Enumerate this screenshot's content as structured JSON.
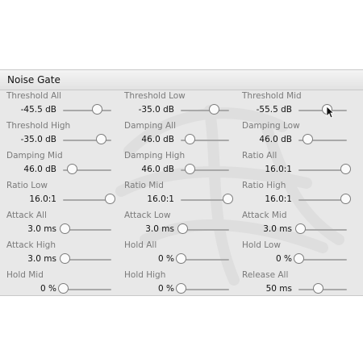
{
  "panel": {
    "title": "Noise Gate",
    "params": [
      {
        "label": "Threshold All",
        "value": "-45.5 dB",
        "level": 0.7
      },
      {
        "label": "Threshold Low",
        "value": "-35.0 dB",
        "level": 0.68
      },
      {
        "label": "Threshold Mid",
        "value": "-55.5 dB",
        "level": 0.58
      },
      {
        "label": "Threshold High",
        "value": "-35.0 dB",
        "level": 0.78
      },
      {
        "label": "Damping All",
        "value": "46.0 dB",
        "level": 0.18
      },
      {
        "label": "Damping Low",
        "value": "46.0 dB",
        "level": 0.18
      },
      {
        "label": "Damping Mid",
        "value": "46.0 dB",
        "level": 0.18
      },
      {
        "label": "Damping High",
        "value": "46.0 dB",
        "level": 0.18
      },
      {
        "label": "Ratio All",
        "value": "16.0:1",
        "level": 0.96
      },
      {
        "label": "Ratio Low",
        "value": "16.0:1",
        "level": 0.96
      },
      {
        "label": "Ratio Mid",
        "value": "16.0:1",
        "level": 0.96
      },
      {
        "label": "Ratio High",
        "value": "16.0:1",
        "level": 0.96
      },
      {
        "label": "Attack All",
        "value": "3.0 ms",
        "level": 0.03
      },
      {
        "label": "Attack Low",
        "value": "3.0 ms",
        "level": 0.03
      },
      {
        "label": "Attack Mid",
        "value": "3.0 ms",
        "level": 0.03
      },
      {
        "label": "Attack High",
        "value": "3.0 ms",
        "level": 0.03
      },
      {
        "label": "Hold All",
        "value": "0 %",
        "level": 0.0
      },
      {
        "label": "Hold Low",
        "value": "0 %",
        "level": 0.0
      },
      {
        "label": "Hold Mid",
        "value": "0 %",
        "level": 0.0
      },
      {
        "label": "Hold High",
        "value": "0 %",
        "level": 0.0
      },
      {
        "label": "Release All",
        "value": "50 ms",
        "level": 0.4
      }
    ]
  },
  "colors": {
    "panel_bg": "#e8e8e8",
    "label": "#7a7a7a",
    "value": "#111111",
    "track": "#a9a9a9"
  },
  "cursor": {
    "icon": "arrow-cursor-icon"
  }
}
